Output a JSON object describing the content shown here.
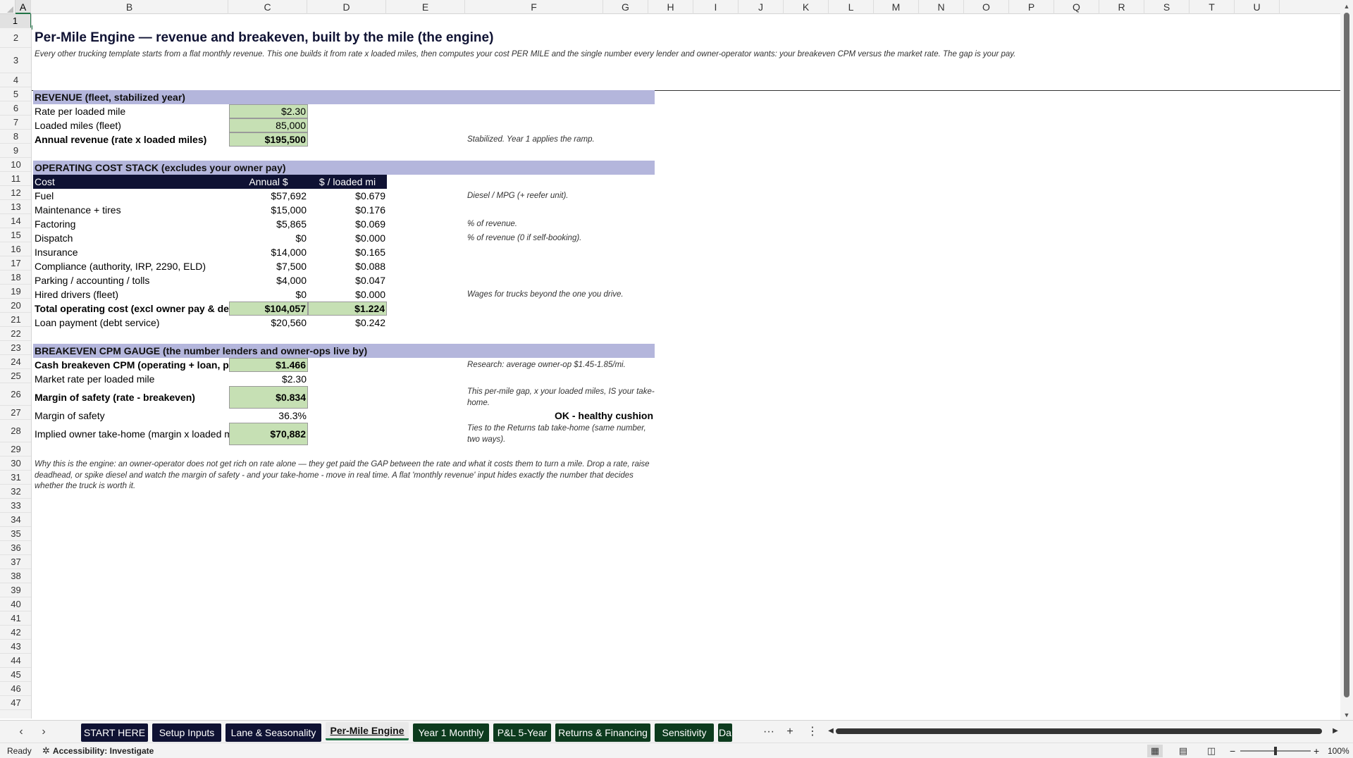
{
  "columns": [
    "A",
    "B",
    "C",
    "D",
    "E",
    "F",
    "G",
    "H",
    "I",
    "J",
    "K",
    "L",
    "M",
    "N",
    "O",
    "P",
    "Q",
    "R",
    "S",
    "T",
    "U"
  ],
  "rows": [
    "1",
    "2",
    "3",
    "4",
    "5",
    "6",
    "7",
    "8",
    "9",
    "10",
    "11",
    "12",
    "13",
    "14",
    "15",
    "16",
    "17",
    "18",
    "19",
    "20",
    "21",
    "22",
    "23",
    "24",
    "25",
    "26",
    "27",
    "28",
    "29",
    "30",
    "31",
    "32",
    "33",
    "34",
    "35",
    "36",
    "37",
    "38",
    "39",
    "40",
    "41",
    "42",
    "43",
    "44",
    "45",
    "46",
    "47"
  ],
  "sheet": {
    "title": "Per-Mile Engine — revenue and breakeven, built by the mile (the engine)",
    "subtitle": "Every other trucking template starts from a flat monthly revenue. This one builds it from rate x loaded miles, then computes your cost PER MILE and the single number every lender and owner-operator wants: your breakeven CPM versus the market rate. The gap is your pay.",
    "revenue": {
      "header": "REVENUE (fleet, stabilized year)",
      "rate_label": "Rate per loaded mile",
      "rate_value": "$2.30",
      "miles_label": "Loaded miles (fleet)",
      "miles_value": "85,000",
      "annual_label": "Annual revenue (rate x loaded miles)",
      "annual_value": "$195,500",
      "annual_note": "Stabilized. Year 1 applies the ramp."
    },
    "costs": {
      "header": "OPERATING COST STACK  (excludes your owner pay)",
      "col_cost": "Cost",
      "col_annual": "Annual $",
      "col_permile": "$ / loaded mi",
      "rows": [
        {
          "label": "Fuel",
          "annual": "$57,692",
          "per_mile": "$0.679",
          "note": "Diesel / MPG (+ reefer unit)."
        },
        {
          "label": "Maintenance + tires",
          "annual": "$15,000",
          "per_mile": "$0.176",
          "note": ""
        },
        {
          "label": "Factoring",
          "annual": "$5,865",
          "per_mile": "$0.069",
          "note": "% of revenue."
        },
        {
          "label": "Dispatch",
          "annual": "$0",
          "per_mile": "$0.000",
          "note": "% of revenue (0 if self-booking)."
        },
        {
          "label": "Insurance",
          "annual": "$14,000",
          "per_mile": "$0.165",
          "note": ""
        },
        {
          "label": "Compliance (authority, IRP, 2290, ELD)",
          "annual": "$7,500",
          "per_mile": "$0.088",
          "note": ""
        },
        {
          "label": "Parking / accounting / tolls",
          "annual": "$4,000",
          "per_mile": "$0.047",
          "note": ""
        },
        {
          "label": "Hired drivers (fleet)",
          "annual": "$0",
          "per_mile": "$0.000",
          "note": "Wages for trucks beyond the one you drive."
        }
      ],
      "total_label": "Total operating cost (excl owner pay & debt)",
      "total_annual": "$104,057",
      "total_per_mile": "$1.224",
      "loan_label": "Loan payment (debt service)",
      "loan_annual": "$20,560",
      "loan_per_mile": "$0.242"
    },
    "breakeven": {
      "header": "BREAKEVEN CPM GAUGE  (the number lenders and owner-ops live by)",
      "cash_label": "Cash breakeven CPM (operating + loan, per loaded mile)",
      "cash_value": "$1.466",
      "cash_note": "Research: average owner-op $1.45-1.85/mi.",
      "market_label": "Market rate per loaded mile",
      "market_value": "$2.30",
      "margin_label": "Margin of safety (rate - breakeven)",
      "margin_value": "$0.834",
      "margin_note": "This per-mile gap, x your loaded miles, IS your take-home.",
      "margin_pct_label": "Margin of safety",
      "margin_pct_value": "36.3%",
      "status": "OK - healthy cushion",
      "takehome_label": "Implied owner take-home (margin x loaded miles)",
      "takehome_value": "$70,882",
      "takehome_note": "Ties to the Returns tab take-home (same number, two ways)."
    },
    "footer_note": "Why this is the engine: an owner-operator does not get rich on rate alone — they get paid the GAP between the rate and what it costs them to turn a mile. Drop a rate, raise deadhead, or spike diesel and watch the margin of safety - and your take-home - move in real time. A flat 'monthly revenue' input hides exactly the number that decides whether the truck is worth it."
  },
  "tabs": [
    {
      "label": "START HERE",
      "style": "navy"
    },
    {
      "label": "Setup Inputs",
      "style": "navy"
    },
    {
      "label": "Lane & Seasonality",
      "style": "navy"
    },
    {
      "label": "Per-Mile Engine",
      "style": "active"
    },
    {
      "label": "Year 1 Monthly",
      "style": "dkgreen"
    },
    {
      "label": "P&L 5-Year",
      "style": "dkgreen"
    },
    {
      "label": "Returns & Financing",
      "style": "dkgreen"
    },
    {
      "label": "Sensitivity",
      "style": "dkgreen"
    },
    {
      "label": "Da",
      "style": "dkgreen"
    }
  ],
  "tab_tools": {
    "more": "···",
    "add": "+",
    "menu": "⋮"
  },
  "status": {
    "ready": "Ready",
    "accessibility": "Accessibility: Investigate",
    "zoom": "100%",
    "zoom_minus": "−",
    "zoom_plus": "+"
  },
  "colors": {
    "band": "#b4b6dc",
    "navy": "#0f1233",
    "input_green": "#c6e0b4",
    "excel_green": "#217346"
  }
}
